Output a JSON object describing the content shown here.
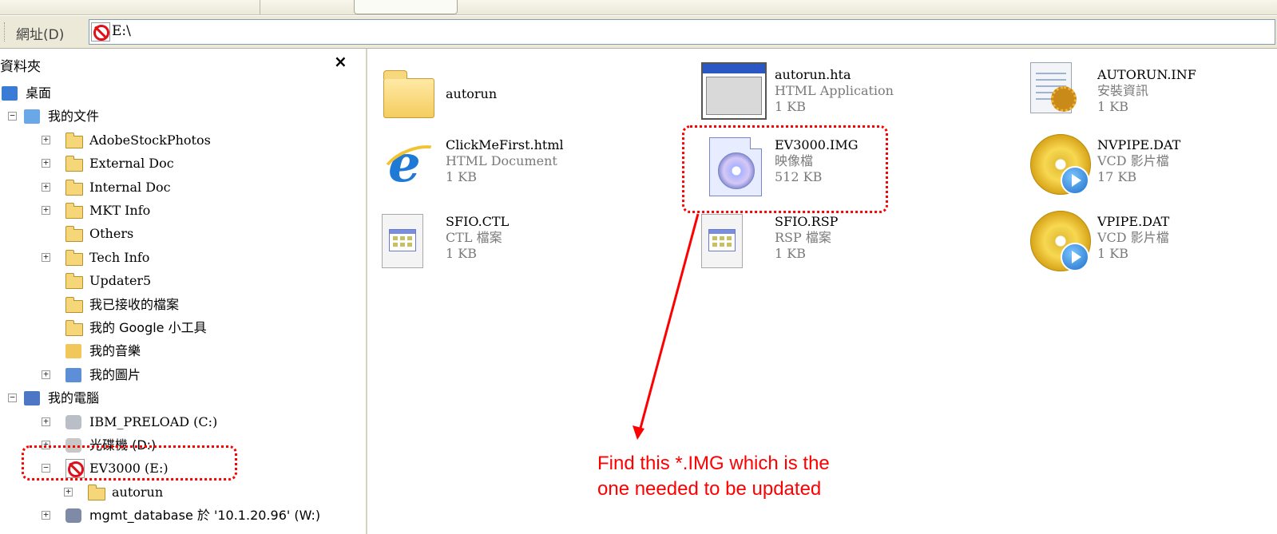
{
  "address_bar": {
    "label": "網址(D)",
    "path": "E:\\"
  },
  "folder_pane": {
    "title": "資料夾",
    "close": "×",
    "tree": [
      {
        "label": "桌面",
        "icon": "desktop-icon",
        "indent": 0,
        "expander": ""
      },
      {
        "label": "我的文件",
        "icon": "my-documents-icon",
        "indent": 0,
        "expander": "−"
      },
      {
        "label": "AdobeStockPhotos",
        "icon": "folder-icon",
        "indent": 1,
        "expander": "+"
      },
      {
        "label": "External Doc",
        "icon": "folder-icon",
        "indent": 1,
        "expander": "+"
      },
      {
        "label": "Internal Doc",
        "icon": "folder-icon",
        "indent": 1,
        "expander": "+"
      },
      {
        "label": "MKT Info",
        "icon": "folder-icon",
        "indent": 1,
        "expander": "+"
      },
      {
        "label": "Others",
        "icon": "folder-icon",
        "indent": 1,
        "expander": ""
      },
      {
        "label": "Tech Info",
        "icon": "folder-icon",
        "indent": 1,
        "expander": "+"
      },
      {
        "label": "Updater5",
        "icon": "folder-icon",
        "indent": 1,
        "expander": ""
      },
      {
        "label": "我已接收的檔案",
        "icon": "folder-icon",
        "indent": 1,
        "expander": ""
      },
      {
        "label": "我的 Google 小工具",
        "icon": "folder-icon",
        "indent": 1,
        "expander": ""
      },
      {
        "label": "我的音樂",
        "icon": "music-folder-icon",
        "indent": 1,
        "expander": ""
      },
      {
        "label": "我的圖片",
        "icon": "pictures-folder-icon",
        "indent": 1,
        "expander": "+"
      },
      {
        "label": "我的電腦",
        "icon": "my-computer-icon",
        "indent": 0,
        "expander": "−"
      },
      {
        "label": "IBM_PRELOAD (C:)",
        "icon": "hard-drive-icon",
        "indent": 1,
        "expander": "+"
      },
      {
        "label": "光碟機 (D:)",
        "icon": "cd-drive-icon",
        "indent": 1,
        "expander": "+"
      },
      {
        "label": "EV3000 (E:)",
        "icon": "no-entry-drive-icon",
        "indent": 1,
        "expander": "−"
      },
      {
        "label": "autorun",
        "icon": "folder-icon",
        "indent": 2,
        "expander": "+"
      },
      {
        "label": "mgmt_database 於 '10.1.20.96' (W:)",
        "icon": "network-drive-icon",
        "indent": 1,
        "expander": "+"
      }
    ]
  },
  "files": [
    {
      "name": "autorun",
      "type": "",
      "size": "",
      "icon": "folder-icon"
    },
    {
      "name": "autorun.hta",
      "type": "HTML Application",
      "size": "1 KB",
      "icon": "hta-window-icon"
    },
    {
      "name": "AUTORUN.INF",
      "type": "安裝資訊",
      "size": "1 KB",
      "icon": "setup-info-icon"
    },
    {
      "name": "ClickMeFirst.html",
      "type": "HTML Document",
      "size": "1 KB",
      "icon": "internet-explorer-icon"
    },
    {
      "name": "EV3000.IMG",
      "type": "映像檔",
      "size": "512 KB",
      "icon": "disc-image-icon"
    },
    {
      "name": "NVPIPE.DAT",
      "type": "VCD 影片檔",
      "size": "17 KB",
      "icon": "vcd-video-icon"
    },
    {
      "name": "SFIO.CTL",
      "type": "CTL 檔案",
      "size": "1 KB",
      "icon": "generic-window-file-icon"
    },
    {
      "name": "SFIO.RSP",
      "type": "RSP 檔案",
      "size": "1 KB",
      "icon": "generic-window-file-icon"
    },
    {
      "name": "VPIPE.DAT",
      "type": "VCD 影片檔",
      "size": "1 KB",
      "icon": "vcd-video-icon"
    }
  ],
  "annotation": {
    "text": "Find this *.IMG which is the one needed to be updated",
    "color": "#ff0000"
  }
}
